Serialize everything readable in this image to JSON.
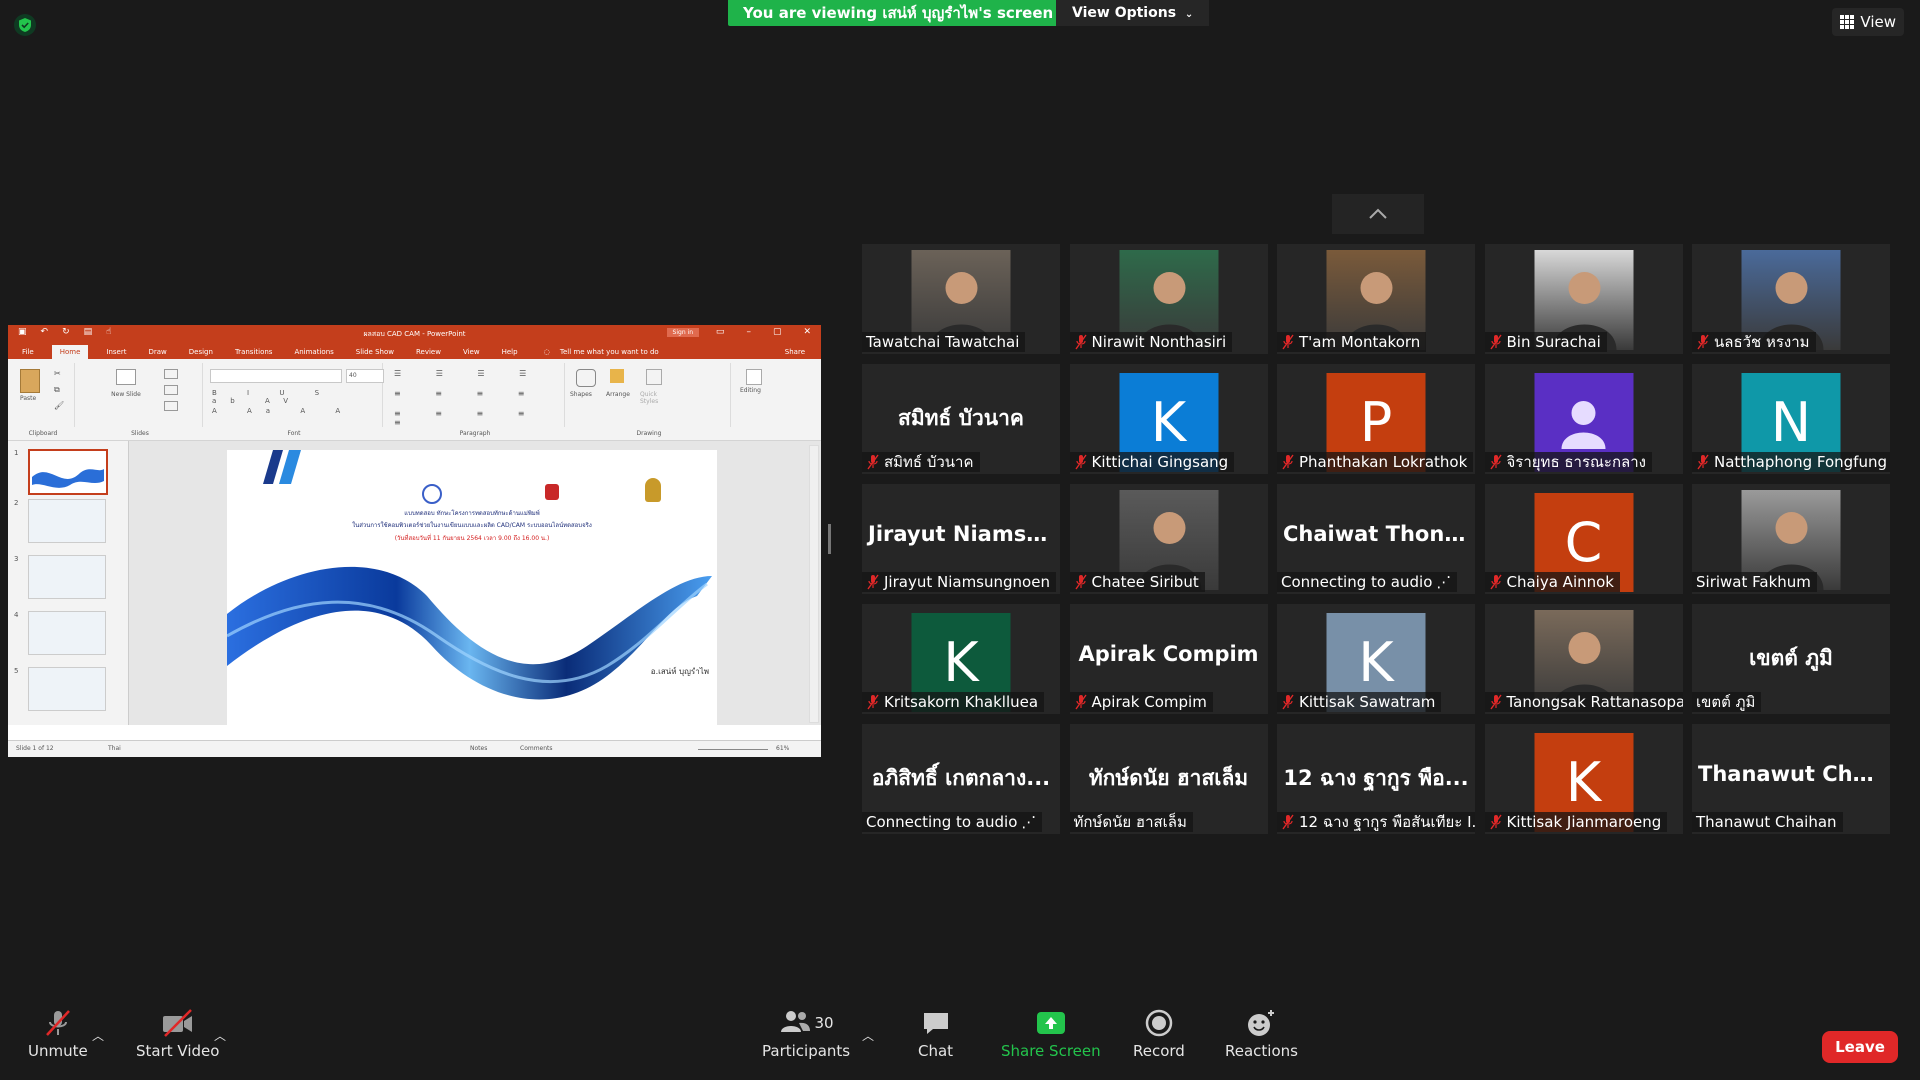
{
  "top": {
    "viewing_banner": "You are viewing เสน่ห์ บุญรำไพ's screen",
    "view_options": "View Options",
    "view": "View"
  },
  "shared_screen": {
    "title": "ผลสอบ CAD CAM - PowerPoint",
    "sign_in": "Sign in",
    "tabs": [
      "File",
      "Home",
      "Insert",
      "Draw",
      "Design",
      "Transitions",
      "Animations",
      "Slide Show",
      "Review",
      "View",
      "Help"
    ],
    "tell_me": "Tell me what you want to do",
    "share": "Share",
    "ribbon": {
      "paste": "Paste",
      "clipboard": "Clipboard",
      "new_slide": "New Slide",
      "slides": "Slides",
      "font": "Font",
      "paragraph": "Paragraph",
      "shapes": "Shapes",
      "arrange": "Arrange",
      "quick_styles": "Quick Styles",
      "drawing": "Drawing",
      "editing": "Editing",
      "font_size": "40"
    },
    "thumb_numbers": [
      "1",
      "2",
      "3",
      "4",
      "5"
    ],
    "slide": {
      "line1": "แบบทดสอบ ทักษะโครงการทดสอบทักษะด้านแม่พิมพ์",
      "line2": "ในส่วนการใช้คอมพิวเตอร์ช่วยในงานเขียนแบบและผลิต CAD/CAM ระบบออนไลน์ทดสอบจริง",
      "line3": "(วันที่สอบวันที่ 11 กันยายน 2564 เวลา 9.00 ถึง 16.00 น.)",
      "author": "อ.เสน่ห์ บุญรำไพ"
    },
    "status": {
      "slide_of": "Slide 1 of 12",
      "language": "Thai",
      "notes": "Notes",
      "comments": "Comments",
      "zoom": "61%"
    }
  },
  "participants": [
    {
      "name": "Tawatchai Tawatchai",
      "type": "photo",
      "muted": false
    },
    {
      "name": "Nirawit Nonthasiri",
      "type": "photo",
      "muted": true
    },
    {
      "name": "T'am Montakorn",
      "type": "photo",
      "muted": true
    },
    {
      "name": "Bin Surachai",
      "type": "photo",
      "muted": true
    },
    {
      "name": "นลธวัช หรงาม",
      "type": "photo",
      "muted": true
    },
    {
      "name": "สมิทธ์ บัวนาค",
      "type": "text",
      "big": "สมิทธ์ บัวนาค",
      "muted": true
    },
    {
      "name": "Kittichai Gingsang",
      "type": "letter",
      "letter": "K",
      "color": "#0b7dd6",
      "muted": true
    },
    {
      "name": "Phanthakan Lokrathok",
      "type": "letter",
      "letter": "P",
      "color": "#c43e0f",
      "muted": true
    },
    {
      "name": "จิรายุทธ ธารณะกลาง",
      "type": "person",
      "color": "#5a2fc4",
      "muted": true
    },
    {
      "name": "Natthaphong Fongfung",
      "type": "letter",
      "letter": "N",
      "color": "#0f98a8",
      "muted": true
    },
    {
      "name": "Jirayut Niamsungnoen",
      "type": "text",
      "big": "Jirayut Niamsu...",
      "muted": true
    },
    {
      "name": "Chatee Siribut",
      "type": "photo",
      "muted": true
    },
    {
      "name": "Connecting to audio",
      "type": "text",
      "big": "Chaiwat Thong...",
      "muted": false,
      "connecting": true
    },
    {
      "name": "Chaiya Ainnok",
      "type": "letter",
      "letter": "C",
      "color": "#c43e0f",
      "muted": true
    },
    {
      "name": "Siriwat Fakhum",
      "type": "photo",
      "muted": false
    },
    {
      "name": "Kritsakorn Khaklluea",
      "type": "letter",
      "letter": "K",
      "color": "#0d5a3c",
      "muted": true
    },
    {
      "name": "Apirak Compim",
      "type": "text",
      "big": "Apirak Compim",
      "muted": true
    },
    {
      "name": "Kittisak Sawatram",
      "type": "letter",
      "letter": "K",
      "color": "#7890a8",
      "muted": true
    },
    {
      "name": "Tanongsak Rattanasopa",
      "type": "photo",
      "muted": true
    },
    {
      "name": "เขตต์ ภูมิ",
      "type": "text",
      "big": "เขตต์ ภูมิ",
      "muted": false
    },
    {
      "name": "Connecting to audio",
      "type": "text",
      "big": "อภิสิทธิ์ เกตกลาง...",
      "muted": false,
      "connecting": true
    },
    {
      "name": "ทักษ์ดนัย ฮาสเล็ม",
      "type": "text",
      "big": "ทักษ์ดนัย ฮาสเล็ม",
      "muted": false
    },
    {
      "name": "12 ฉาง ฐากูร พือสันเทียะ I...",
      "type": "text",
      "big": "12 ฉาง ฐากูร พือ...",
      "muted": true
    },
    {
      "name": "Kittisak Jianmaroeng",
      "type": "letter",
      "letter": "K",
      "color": "#c43e0f",
      "muted": true
    },
    {
      "name": "Thanawut Chaihan",
      "type": "text",
      "big": "Thanawut Chaih...",
      "muted": false
    }
  ],
  "toolbar": {
    "unmute": "Unmute",
    "start_video": "Start Video",
    "participants": "Participants",
    "participants_count": "30",
    "chat": "Chat",
    "share_screen": "Share Screen",
    "record": "Record",
    "reactions": "Reactions",
    "leave": "Leave"
  },
  "colors": {
    "banner_green": "#1fb34a",
    "leave_red": "#e02828",
    "share_green": "#23c44c",
    "powerpoint_red": "#c43e1c"
  }
}
